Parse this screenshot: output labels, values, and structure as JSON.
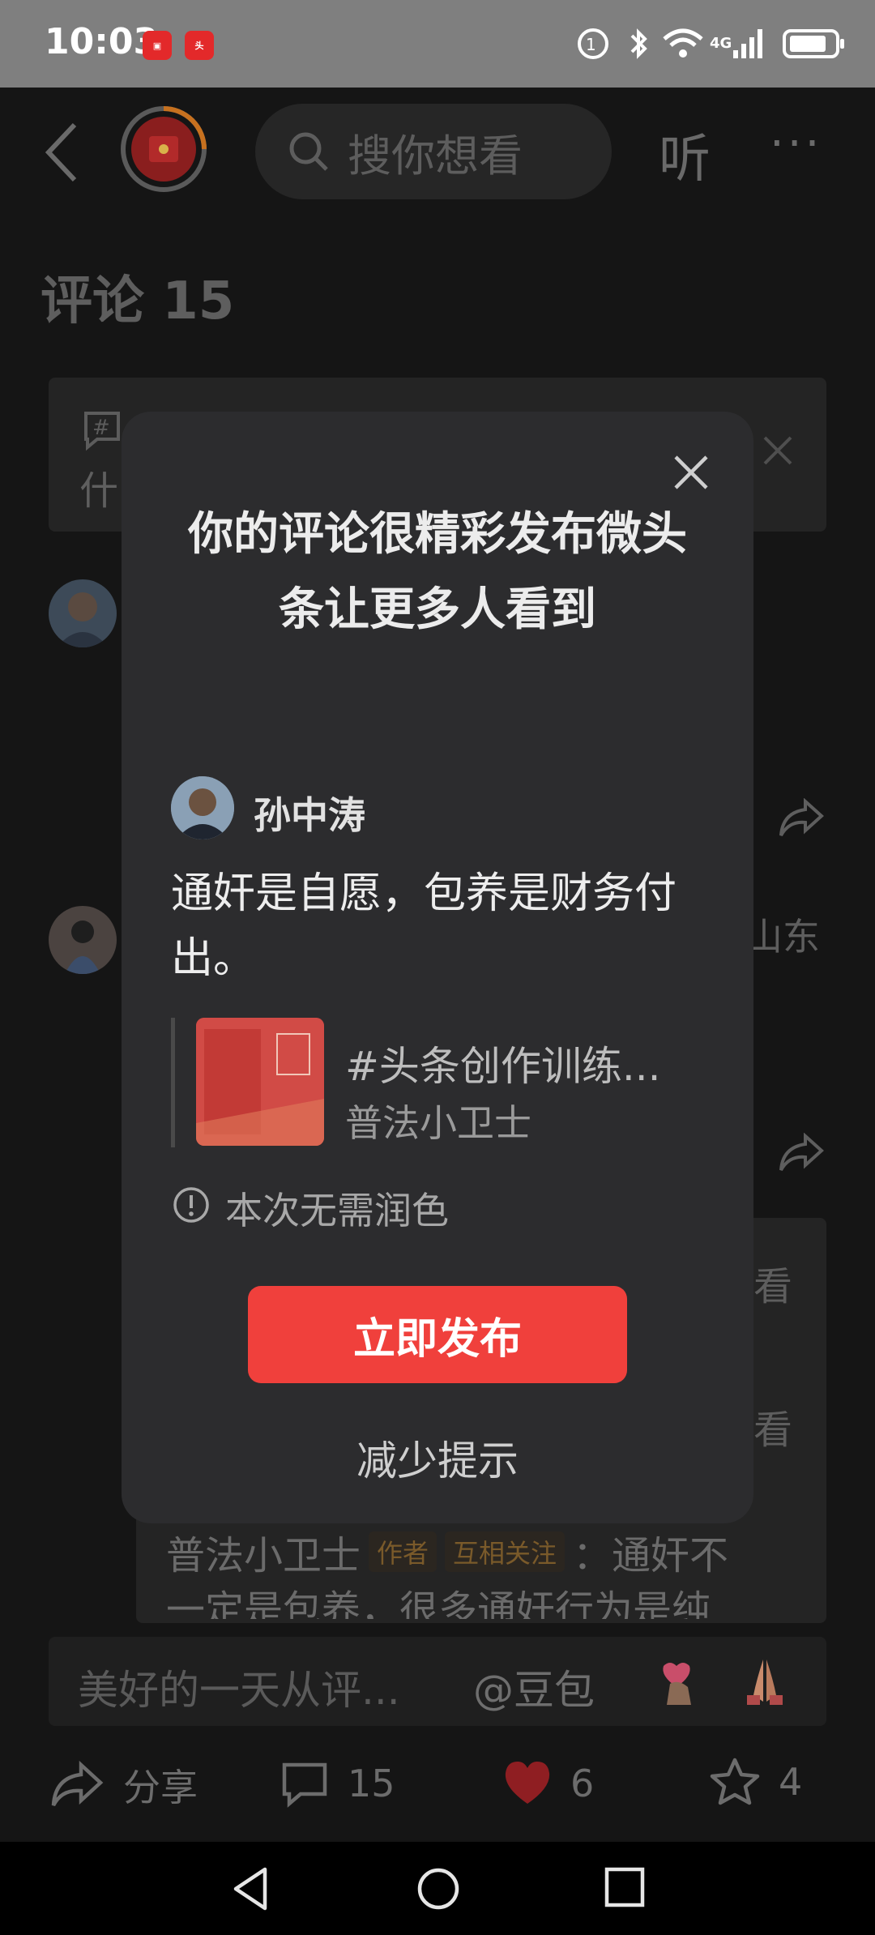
{
  "status": {
    "time": "10:03",
    "network": "4G"
  },
  "header": {
    "search_placeholder": "搜你想看",
    "listen": "听",
    "more": "···"
  },
  "comments": {
    "title": "评论 15",
    "hint_short": "什",
    "region": "山东",
    "reply_see": "看",
    "reply_author": "普法小卫士",
    "reply_tag_author": "作者",
    "reply_tag_mutual": "互相关注",
    "reply_text_1": "：通奸不",
    "reply_text_2": "一定是包养，很多通奸行为是纯"
  },
  "modal": {
    "title": "你的评论很精彩发布微头条让更多人看到",
    "user_name": "孙中涛",
    "comment_text": "通奸是自愿，包养是财务付出。",
    "ref_title": "#头条创作训练...",
    "ref_author": "普法小卫士",
    "notice": "本次无需润色",
    "publish_button": "立即发布",
    "reduce_button": "减少提示",
    "accent_color": "#f0403c"
  },
  "comment_bar": {
    "placeholder": "美好的一天从评...",
    "mention": "@豆包"
  },
  "actions": {
    "share": "分享",
    "comment_count": "15",
    "like_count": "6",
    "favorite_count": "4"
  }
}
